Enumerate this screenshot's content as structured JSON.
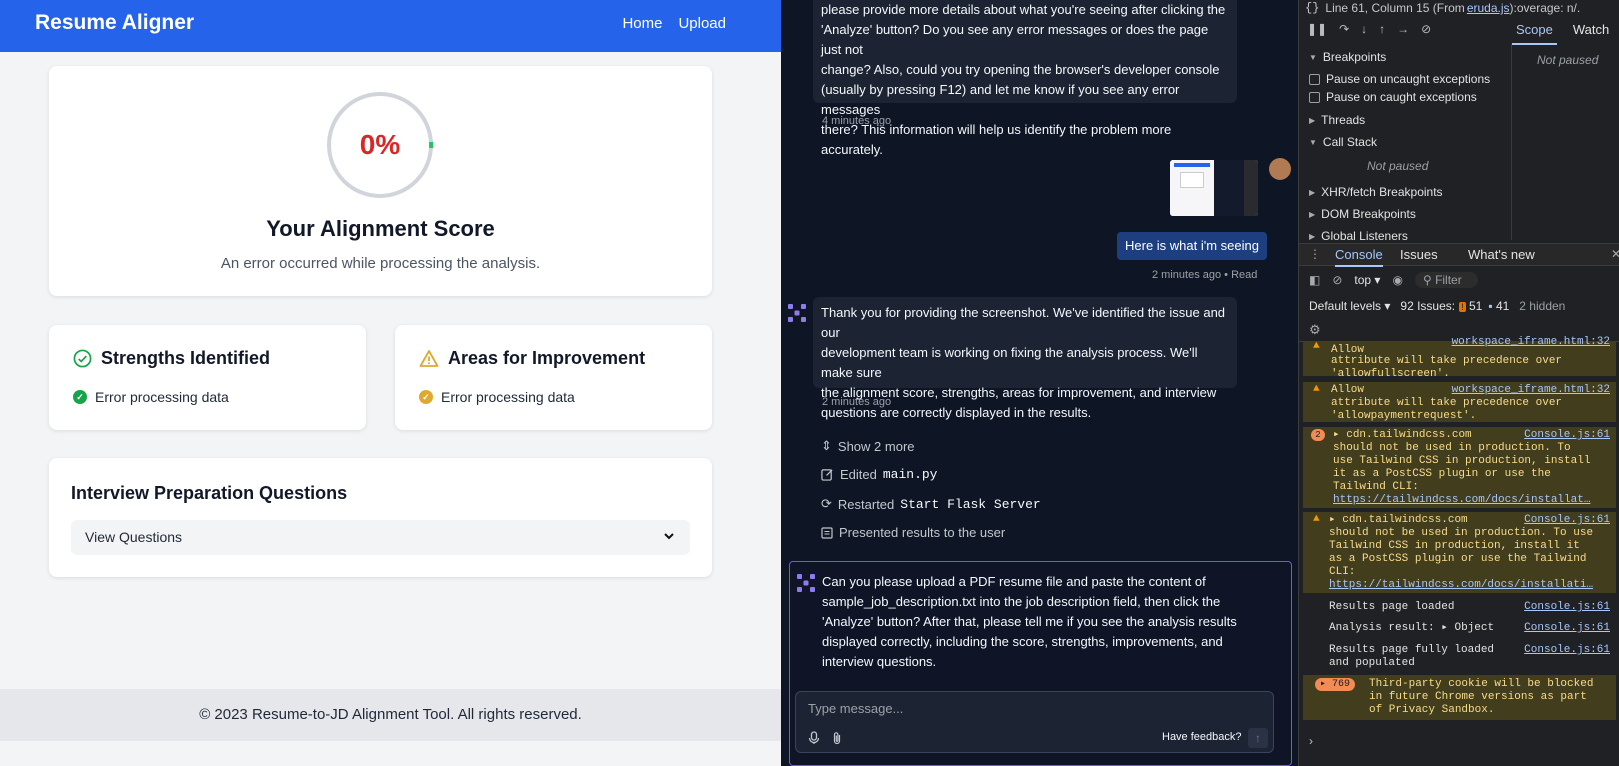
{
  "app": {
    "brand": "Resume Aligner",
    "nav": [
      "Home",
      "Upload"
    ],
    "score": {
      "value_text": "0%",
      "title": "Your Alignment Score",
      "message": "An error occurred while processing the analysis."
    },
    "strengths": {
      "title": "Strengths Identified",
      "item": "Error processing data"
    },
    "improvements": {
      "title": "Areas for Improvement",
      "item": "Error processing data"
    },
    "interview": {
      "title": "Interview Preparation Questions",
      "select_label": "View Questions"
    },
    "footer": "© 2023 Resume-to-JD Alignment Tool. All rights reserved.",
    "colors": {
      "nav": "#2563eb",
      "score": "#dc2626",
      "success": "#16a34a",
      "warning": "#e0a82e"
    }
  },
  "chat": {
    "msg1_lines": [
      "please provide more details about what you're seeing after clicking the",
      "'Analyze' button? Do you see any error messages or does the page just not",
      "change? Also, could you try opening the browser's developer console",
      "(usually by pressing F12) and let me know if you see any error messages",
      "there? This information will help us identify the problem more accurately."
    ],
    "msg1_time": "4 minutes ago",
    "user_msg": "Here is what i'm seeing",
    "user_meta": "2 minutes ago • Read",
    "msg2_lines": [
      "Thank you for providing the screenshot. We've identified the issue and our",
      "development team is working on fixing the analysis process. We'll make sure",
      "the alignment score, strengths, areas for improvement, and interview",
      "questions are correctly displayed in the results."
    ],
    "msg2_time": "2 minutes ago",
    "actions": {
      "show_more": "Show 2 more",
      "edited_label": "Edited",
      "edited_file": "main.py",
      "restarted_label": "Restarted",
      "restarted_name": "Start Flask Server",
      "presented": "Presented results to the user"
    },
    "msg3_lines": [
      "Can you please upload a PDF resume file and paste the content of",
      "sample_job_description.txt into the job description field, then click the",
      "'Analyze' button? After that, please tell me if you see the analysis results",
      "displayed correctly, including the score, strengths, improvements, and",
      "interview questions."
    ],
    "input_placeholder": "Type message...",
    "feedback": "Have feedback?"
  },
  "devtools": {
    "status_line": "Line 61, Column 15  (From",
    "status_link": "eruda.js",
    "status_tail": "):overage: n/.",
    "tabs_top": [
      "Scope",
      "Watch"
    ],
    "breakpoints": "Breakpoints",
    "pause_uncaught": "Pause on uncaught exceptions",
    "pause_caught": "Pause on caught exceptions",
    "threads": "Threads",
    "call_stack": "Call Stack",
    "not_paused": "Not paused",
    "xhr": "XHR/fetch Breakpoints",
    "dom": "DOM Breakpoints",
    "global": "Global Listeners",
    "console_tabs": [
      "Console",
      "Issues",
      "What's new"
    ],
    "context": "top",
    "filter": "Filter",
    "levels": "Default levels",
    "issues_label": "92 Issues:",
    "issues_warn": "51",
    "issues_info": "41",
    "hidden": "2 hidden",
    "entries": {
      "w0_lines": [
        "Allow",
        "attribute will take precedence over",
        "'allowfullscreen'."
      ],
      "w0_link": "workspace_iframe.html:32",
      "w1_lines": [
        "Allow",
        "attribute will take precedence over",
        "'allowpaymentrequest'."
      ],
      "w1_link": "workspace_iframe.html:32",
      "w2_count": "2",
      "w2_lines": [
        "cdn.tailwindcss.com",
        "should not be used in production. To",
        "use Tailwind CSS in production, install",
        "it as a PostCSS plugin or use the",
        "Tailwind CLI:"
      ],
      "w2_url": "https://tailwindcss.com/docs/installat…",
      "w2_link": "Console.js:61",
      "w3_lines": [
        "cdn.tailwindcss.com",
        "should not be used in production. To use",
        "Tailwind CSS in production, install it",
        "as a PostCSS plugin or use the Tailwind",
        "CLI:"
      ],
      "w3_url": "https://tailwindcss.com/docs/installati…",
      "w3_link": "Console.js:61",
      "l1": "Results page loaded",
      "l1_link": "Console.js:61",
      "l2": "Analysis result:",
      "l2_obj": "Object",
      "l2_link": "Console.js:61",
      "l3_lines": [
        "Results page fully loaded",
        "and populated"
      ],
      "l3_link": "Console.js:61",
      "cookie_count": "769",
      "cookie_lines": [
        "Third-party cookie will be blocked",
        "in future Chrome versions as part",
        "of Privacy Sandbox."
      ]
    }
  }
}
